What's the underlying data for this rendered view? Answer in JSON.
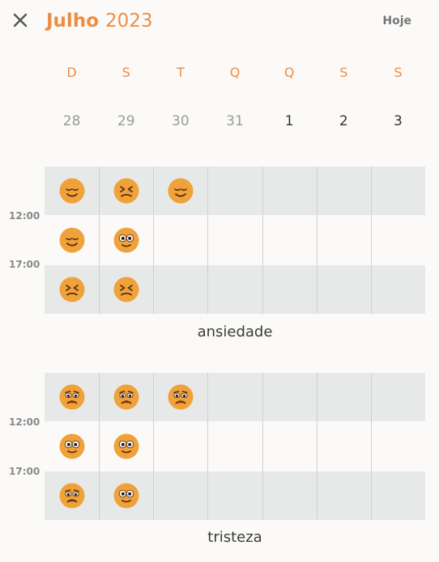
{
  "header": {
    "month": "Julho",
    "year": "2023",
    "today_label": "Hoje",
    "close_icon": "close-icon"
  },
  "week": {
    "day_names": [
      "D",
      "S",
      "T",
      "Q",
      "Q",
      "S",
      "S"
    ],
    "day_numbers": [
      {
        "label": "28",
        "muted": true
      },
      {
        "label": "29",
        "muted": true
      },
      {
        "label": "30",
        "muted": true
      },
      {
        "label": "31",
        "muted": true
      },
      {
        "label": "1",
        "muted": false
      },
      {
        "label": "2",
        "muted": false
      },
      {
        "label": "3",
        "muted": false
      }
    ]
  },
  "colors": {
    "accent": "#ee8c43",
    "emoji_face": "#f0a23a",
    "band": "#e7e8e8"
  },
  "time_labels": [
    "12:00",
    "17:00"
  ],
  "moods": [
    {
      "name": "ansiedade",
      "slots": [
        [
          "content",
          "squint",
          "content",
          null,
          null,
          null,
          null
        ],
        [
          "content",
          "wide-eyed",
          null,
          null,
          null,
          null,
          null
        ],
        [
          "squint",
          "squint",
          null,
          null,
          null,
          null,
          null
        ]
      ]
    },
    {
      "name": "tristeza",
      "slots": [
        [
          "sad",
          "sad",
          "sad",
          null,
          null,
          null,
          null
        ],
        [
          "wide-eyed",
          "wide-eyed",
          null,
          null,
          null,
          null,
          null
        ],
        [
          "sad",
          "wide-eyed",
          null,
          null,
          null,
          null,
          null
        ]
      ]
    }
  ]
}
